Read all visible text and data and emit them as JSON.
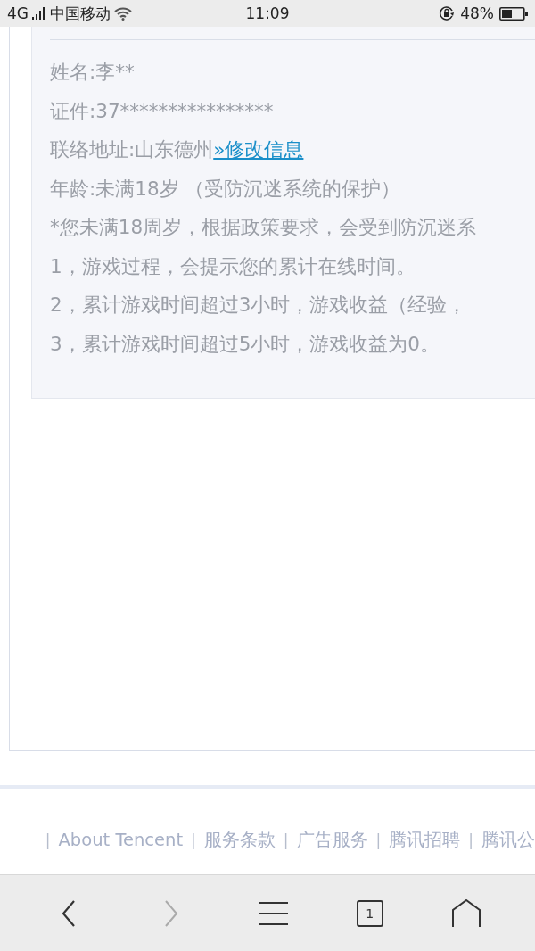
{
  "status_bar": {
    "network": "4G",
    "carrier": "中国移动",
    "time": "11:09",
    "battery": "48%"
  },
  "info": {
    "lines": [
      {
        "text": "姓名:李**"
      },
      {
        "text": "证件:37****************"
      },
      {
        "text": "联络地址:山东德州",
        "link": "»修改信息"
      },
      {
        "text": "年龄:未满18岁 （受防沉迷系统的保护）"
      },
      {
        "text": "*您未满18周岁，根据政策要求，会受到防沉迷系"
      },
      {
        "text": "1，游戏过程，会提示您的累计在线时间。"
      },
      {
        "text": "2，累计游戏时间超过3小时，游戏收益（经验，"
      },
      {
        "text": "3，累计游戏时间超过5小时，游戏收益为0。"
      }
    ]
  },
  "footer": {
    "items": [
      {
        "kind": "separator",
        "text": "|"
      },
      {
        "kind": "link",
        "text": "About Tencent"
      },
      {
        "kind": "separator",
        "text": "|"
      },
      {
        "kind": "link",
        "text": "服务条款"
      },
      {
        "kind": "separator",
        "text": "|"
      },
      {
        "kind": "link",
        "text": "广告服务"
      },
      {
        "kind": "separator",
        "text": "|"
      },
      {
        "kind": "link",
        "text": "腾讯招聘"
      },
      {
        "kind": "separator",
        "text": "|"
      },
      {
        "kind": "link",
        "text": "腾讯公"
      }
    ]
  },
  "toolbar": {
    "buttons": [
      {
        "kind": "back",
        "disabled": false
      },
      {
        "kind": "forward",
        "disabled": true
      },
      {
        "kind": "menu",
        "disabled": false
      },
      {
        "kind": "tabs",
        "label": "1",
        "disabled": false
      },
      {
        "kind": "home",
        "disabled": false
      }
    ]
  }
}
